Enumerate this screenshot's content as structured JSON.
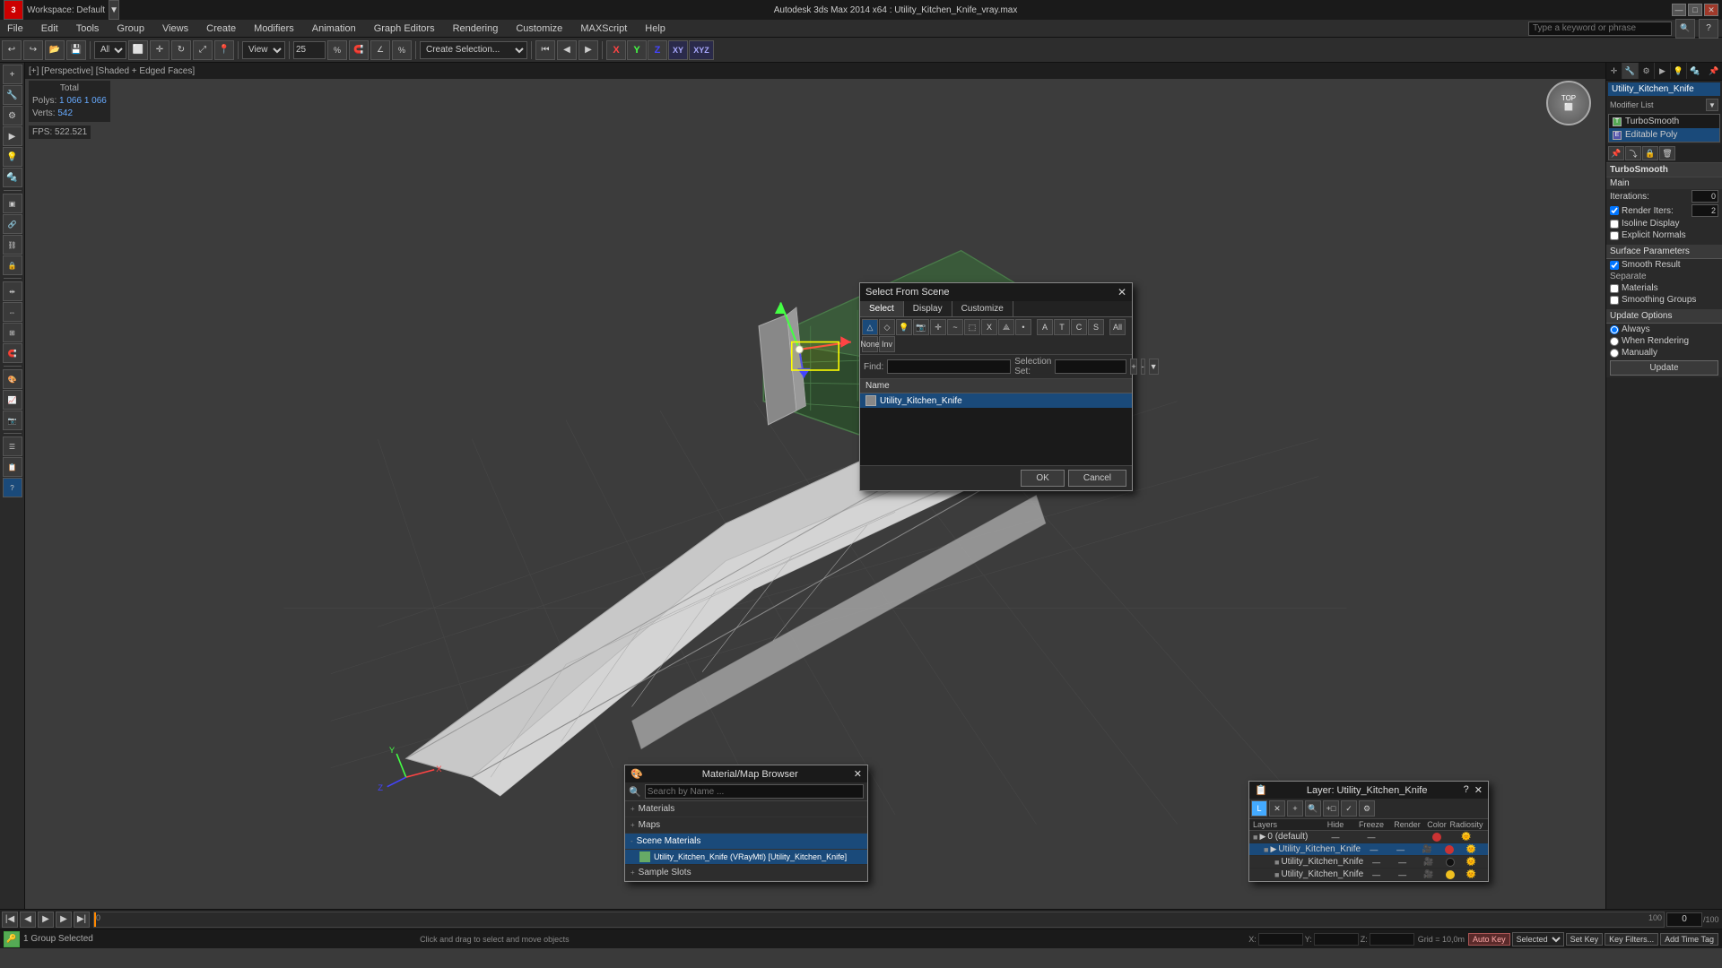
{
  "titlebar": {
    "app": "Autodesk 3ds Max 2014 x64",
    "file": "Utility_Kitchen_Knife_vray.max",
    "workspace": "Workspace: Default",
    "full_title": "Autodesk 3ds Max 2014 x64 : Utility_Kitchen_Knife_vray.max",
    "minimize": "—",
    "maximize": "□",
    "close": "✕"
  },
  "menu": {
    "items": [
      "File",
      "Edit",
      "Tools",
      "Group",
      "Views",
      "Create",
      "Modifiers",
      "Animation",
      "Graph Editors",
      "Rendering",
      "Customize",
      "MAXScript",
      "Help"
    ],
    "search_placeholder": "Type a keyword or phrase"
  },
  "toolbar": {
    "zoom_pct": "25",
    "view_label": "View",
    "filter_label": "All",
    "create_selection": "Create Selection..."
  },
  "viewport": {
    "label": "[+] [Perspective] [Shaded + Edged Faces]",
    "total_label": "Total",
    "polys_label": "Polys:",
    "polys_val": "1 066",
    "verts_label": "Verts:",
    "verts_val": "542",
    "fps_label": "FPS:",
    "fps_val": "522.521"
  },
  "right_panel": {
    "obj_name": "Utility_Kitchen_Knife",
    "modifier_label": "Modifier List",
    "modifiers": [
      {
        "name": "TurboSmooth",
        "active": false
      },
      {
        "name": "Editable Poly",
        "active": true
      }
    ],
    "panel_title": "TurboSmooth",
    "main_section": "Main",
    "iterations_label": "Iterations:",
    "iterations_val": "0",
    "render_iters_label": "Render Iters:",
    "render_iters_val": "2",
    "render_iters_check": true,
    "isoline_label": "Isoline Display",
    "explicit_normals_label": "Explicit Normals",
    "surface_params": "Surface Parameters",
    "smooth_result_label": "Smooth Result",
    "smooth_result_check": true,
    "separate_label": "Separate",
    "materials_label": "Materials",
    "smoothing_groups_label": "Smoothing Groups",
    "update_options": "Update Options",
    "always_label": "Always",
    "when_rendering_label": "When Rendering",
    "manually_label": "Manually",
    "update_label": "Update"
  },
  "select_dialog": {
    "title": "Select From Scene",
    "close": "✕",
    "tabs": [
      "Select",
      "Display",
      "Customize"
    ],
    "find_label": "Find:",
    "find_placeholder": "",
    "selection_set_label": "Selection Set:",
    "name_header": "Name",
    "items": [
      {
        "name": "Utility_Kitchen_Knife",
        "selected": true
      }
    ],
    "ok_label": "OK",
    "cancel_label": "Cancel"
  },
  "mat_browser": {
    "title": "Material/Map Browser",
    "close": "✕",
    "search_placeholder": "Search by Name ...",
    "sections": [
      {
        "label": "+ Materials",
        "expanded": false
      },
      {
        "label": "+ Maps",
        "expanded": false
      },
      {
        "label": "- Scene Materials",
        "expanded": true,
        "active": true
      },
      {
        "label": "+ Sample Slots",
        "expanded": false
      }
    ],
    "scene_items": [
      {
        "name": "Utility_Kitchen_Knife (VRayMtl) [Utility_Kitchen_Knife]",
        "selected": true
      }
    ]
  },
  "layer_panel": {
    "title": "Layer: Utility_Kitchen_Knife",
    "close": "✕",
    "help": "?",
    "headers": {
      "name": "Layers",
      "hide": "Hide",
      "freeze": "Freeze",
      "render": "Render",
      "color": "Color",
      "radiosity": "Radiosity"
    },
    "layers": [
      {
        "name": "0 (default)",
        "indent": 0,
        "hide": "—",
        "freeze": "—",
        "render": "",
        "color": "#cc3333",
        "radiosity": "",
        "active": false
      },
      {
        "name": "Utility_Kitchen_Knife",
        "indent": 1,
        "hide": "—",
        "freeze": "—",
        "render": "",
        "color": "#cc3333",
        "radiosity": "",
        "active": true
      },
      {
        "name": "Utility_Kitchen_Knife",
        "indent": 2,
        "hide": "—",
        "freeze": "—",
        "render": "",
        "color": "#111111",
        "radiosity": "",
        "active": false
      },
      {
        "name": "Utility_Kitchen_Knife",
        "indent": 2,
        "hide": "—",
        "freeze": "—",
        "render": "",
        "color": "#f0c020",
        "radiosity": "",
        "active": false
      }
    ]
  },
  "status_bar": {
    "selection_info": "1 Group Selected",
    "hint": "Click and drag to select and move objects",
    "x_label": "X:",
    "x_val": "",
    "y_label": "Y:",
    "y_val": "",
    "z_label": "Z:",
    "z_val": "",
    "grid_label": "Grid = 10,0m",
    "key_label": "Auto Key",
    "selected_label": "Selected",
    "add_time_tag": "Add Time Tag"
  },
  "timeline": {
    "start": "0",
    "end": "100",
    "current": "0"
  }
}
